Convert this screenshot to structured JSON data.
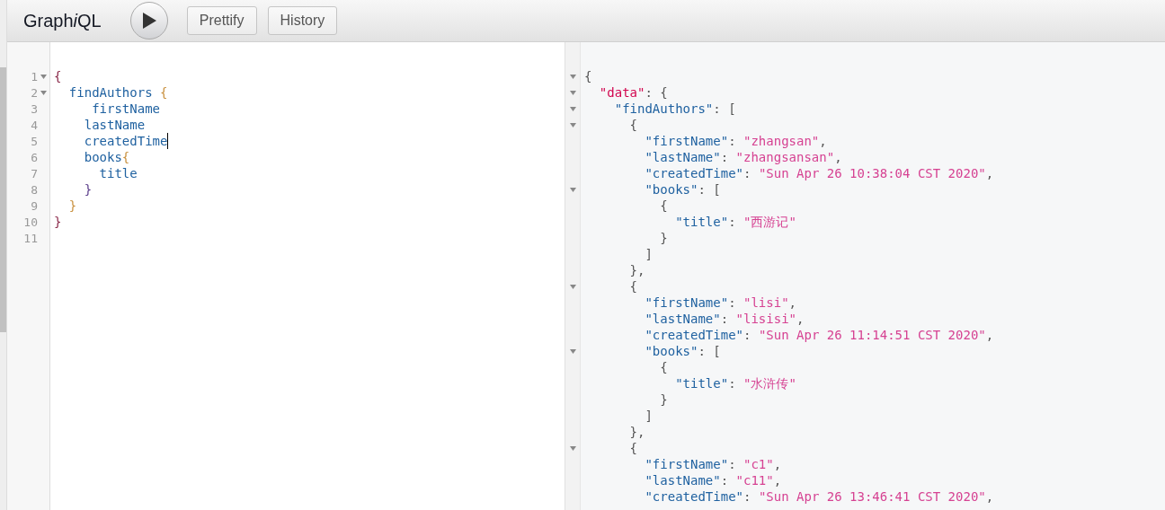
{
  "toolbar": {
    "title_parts": [
      {
        "text": "Graph",
        "italic": false
      },
      {
        "text": "i",
        "italic": true
      },
      {
        "text": "QL",
        "italic": false
      }
    ],
    "buttons": [
      {
        "kind": "run"
      },
      {
        "kind": "text",
        "label": "Prettify"
      },
      {
        "kind": "text",
        "label": "History"
      }
    ]
  },
  "query_editor": {
    "lines": [
      {
        "number": "1",
        "foldable": true,
        "cursor": false,
        "tokens": [
          {
            "kind": "brace",
            "text": "{"
          }
        ]
      },
      {
        "number": "2",
        "foldable": true,
        "cursor": false,
        "tokens": [
          {
            "kind": "field",
            "text": "  findAuthors "
          },
          {
            "kind": "brace2",
            "text": "{"
          }
        ]
      },
      {
        "number": "3",
        "foldable": false,
        "cursor": false,
        "tokens": [
          {
            "kind": "field",
            "text": "     firstName"
          }
        ]
      },
      {
        "number": "4",
        "foldable": false,
        "cursor": false,
        "tokens": [
          {
            "kind": "field",
            "text": "    lastName"
          }
        ]
      },
      {
        "number": "5",
        "foldable": false,
        "cursor": true,
        "tokens": [
          {
            "kind": "field",
            "text": "    createdTime"
          }
        ]
      },
      {
        "number": "6",
        "foldable": false,
        "cursor": false,
        "tokens": [
          {
            "kind": "field",
            "text": "    books"
          },
          {
            "kind": "brace2",
            "text": "{"
          }
        ]
      },
      {
        "number": "7",
        "foldable": false,
        "cursor": false,
        "tokens": [
          {
            "kind": "field",
            "text": "      title"
          }
        ]
      },
      {
        "number": "8",
        "foldable": false,
        "cursor": false,
        "tokens": [
          {
            "kind": "brace3",
            "text": "    }"
          }
        ]
      },
      {
        "number": "9",
        "foldable": false,
        "cursor": false,
        "tokens": [
          {
            "kind": "brace2",
            "text": "  }"
          }
        ]
      },
      {
        "number": "10",
        "foldable": false,
        "cursor": false,
        "tokens": [
          {
            "kind": "brace",
            "text": "}"
          }
        ]
      },
      {
        "number": "11",
        "foldable": false,
        "cursor": false
      }
    ]
  },
  "result_viewer": {
    "lines": [
      {
        "foldable": true,
        "tokens": [
          {
            "kind": "punct",
            "text": "{"
          }
        ]
      },
      {
        "foldable": true,
        "tokens": [
          {
            "kind": "root-key",
            "text": "  \"data\""
          },
          {
            "kind": "punct",
            "text": ": {"
          }
        ]
      },
      {
        "foldable": true,
        "tokens": [
          {
            "kind": "key",
            "text": "    \"findAuthors\""
          },
          {
            "kind": "punct",
            "text": ": ["
          }
        ]
      },
      {
        "foldable": true,
        "tokens": [
          {
            "kind": "punct",
            "text": "      {"
          }
        ]
      },
      {
        "foldable": false,
        "tokens": [
          {
            "kind": "key",
            "text": "        \"firstName\""
          },
          {
            "kind": "punct",
            "text": ": "
          },
          {
            "kind": "string",
            "text": "\"zhangsan\""
          },
          {
            "kind": "punct",
            "text": ","
          }
        ]
      },
      {
        "foldable": false,
        "tokens": [
          {
            "kind": "key",
            "text": "        \"lastName\""
          },
          {
            "kind": "punct",
            "text": ": "
          },
          {
            "kind": "string",
            "text": "\"zhangsansan\""
          },
          {
            "kind": "punct",
            "text": ","
          }
        ]
      },
      {
        "foldable": false,
        "tokens": [
          {
            "kind": "key",
            "text": "        \"createdTime\""
          },
          {
            "kind": "punct",
            "text": ": "
          },
          {
            "kind": "string",
            "text": "\"Sun Apr 26 10:38:04 CST 2020\""
          },
          {
            "kind": "punct",
            "text": ","
          }
        ]
      },
      {
        "foldable": true,
        "tokens": [
          {
            "kind": "key",
            "text": "        \"books\""
          },
          {
            "kind": "punct",
            "text": ": ["
          }
        ]
      },
      {
        "foldable": false,
        "tokens": [
          {
            "kind": "punct",
            "text": "          {"
          }
        ]
      },
      {
        "foldable": false,
        "tokens": [
          {
            "kind": "key",
            "text": "            \"title\""
          },
          {
            "kind": "punct",
            "text": ": "
          },
          {
            "kind": "string",
            "text": "\"西游记\""
          }
        ]
      },
      {
        "foldable": false,
        "tokens": [
          {
            "kind": "punct",
            "text": "          }"
          }
        ]
      },
      {
        "foldable": false,
        "tokens": [
          {
            "kind": "punct",
            "text": "        ]"
          }
        ]
      },
      {
        "foldable": false,
        "tokens": [
          {
            "kind": "punct",
            "text": "      },"
          }
        ]
      },
      {
        "foldable": true,
        "tokens": [
          {
            "kind": "punct",
            "text": "      {"
          }
        ]
      },
      {
        "foldable": false,
        "tokens": [
          {
            "kind": "key",
            "text": "        \"firstName\""
          },
          {
            "kind": "punct",
            "text": ": "
          },
          {
            "kind": "string",
            "text": "\"lisi\""
          },
          {
            "kind": "punct",
            "text": ","
          }
        ]
      },
      {
        "foldable": false,
        "tokens": [
          {
            "kind": "key",
            "text": "        \"lastName\""
          },
          {
            "kind": "punct",
            "text": ": "
          },
          {
            "kind": "string",
            "text": "\"lisisi\""
          },
          {
            "kind": "punct",
            "text": ","
          }
        ]
      },
      {
        "foldable": false,
        "tokens": [
          {
            "kind": "key",
            "text": "        \"createdTime\""
          },
          {
            "kind": "punct",
            "text": ": "
          },
          {
            "kind": "string",
            "text": "\"Sun Apr 26 11:14:51 CST 2020\""
          },
          {
            "kind": "punct",
            "text": ","
          }
        ]
      },
      {
        "foldable": true,
        "tokens": [
          {
            "kind": "key",
            "text": "        \"books\""
          },
          {
            "kind": "punct",
            "text": ": ["
          }
        ]
      },
      {
        "foldable": false,
        "tokens": [
          {
            "kind": "punct",
            "text": "          {"
          }
        ]
      },
      {
        "foldable": false,
        "tokens": [
          {
            "kind": "key",
            "text": "            \"title\""
          },
          {
            "kind": "punct",
            "text": ": "
          },
          {
            "kind": "string",
            "text": "\"水浒传\""
          }
        ]
      },
      {
        "foldable": false,
        "tokens": [
          {
            "kind": "punct",
            "text": "          }"
          }
        ]
      },
      {
        "foldable": false,
        "tokens": [
          {
            "kind": "punct",
            "text": "        ]"
          }
        ]
      },
      {
        "foldable": false,
        "tokens": [
          {
            "kind": "punct",
            "text": "      },"
          }
        ]
      },
      {
        "foldable": true,
        "tokens": [
          {
            "kind": "punct",
            "text": "      {"
          }
        ]
      },
      {
        "foldable": false,
        "tokens": [
          {
            "kind": "key",
            "text": "        \"firstName\""
          },
          {
            "kind": "punct",
            "text": ": "
          },
          {
            "kind": "string",
            "text": "\"c1\""
          },
          {
            "kind": "punct",
            "text": ","
          }
        ]
      },
      {
        "foldable": false,
        "tokens": [
          {
            "kind": "key",
            "text": "        \"lastName\""
          },
          {
            "kind": "punct",
            "text": ": "
          },
          {
            "kind": "string",
            "text": "\"c11\""
          },
          {
            "kind": "punct",
            "text": ","
          }
        ]
      },
      {
        "foldable": false,
        "tokens": [
          {
            "kind": "key",
            "text": "        \"createdTime\""
          },
          {
            "kind": "punct",
            "text": ": "
          },
          {
            "kind": "string",
            "text": "\"Sun Apr 26 13:46:41 CST 2020\""
          },
          {
            "kind": "punct",
            "text": ","
          }
        ]
      }
    ]
  }
}
